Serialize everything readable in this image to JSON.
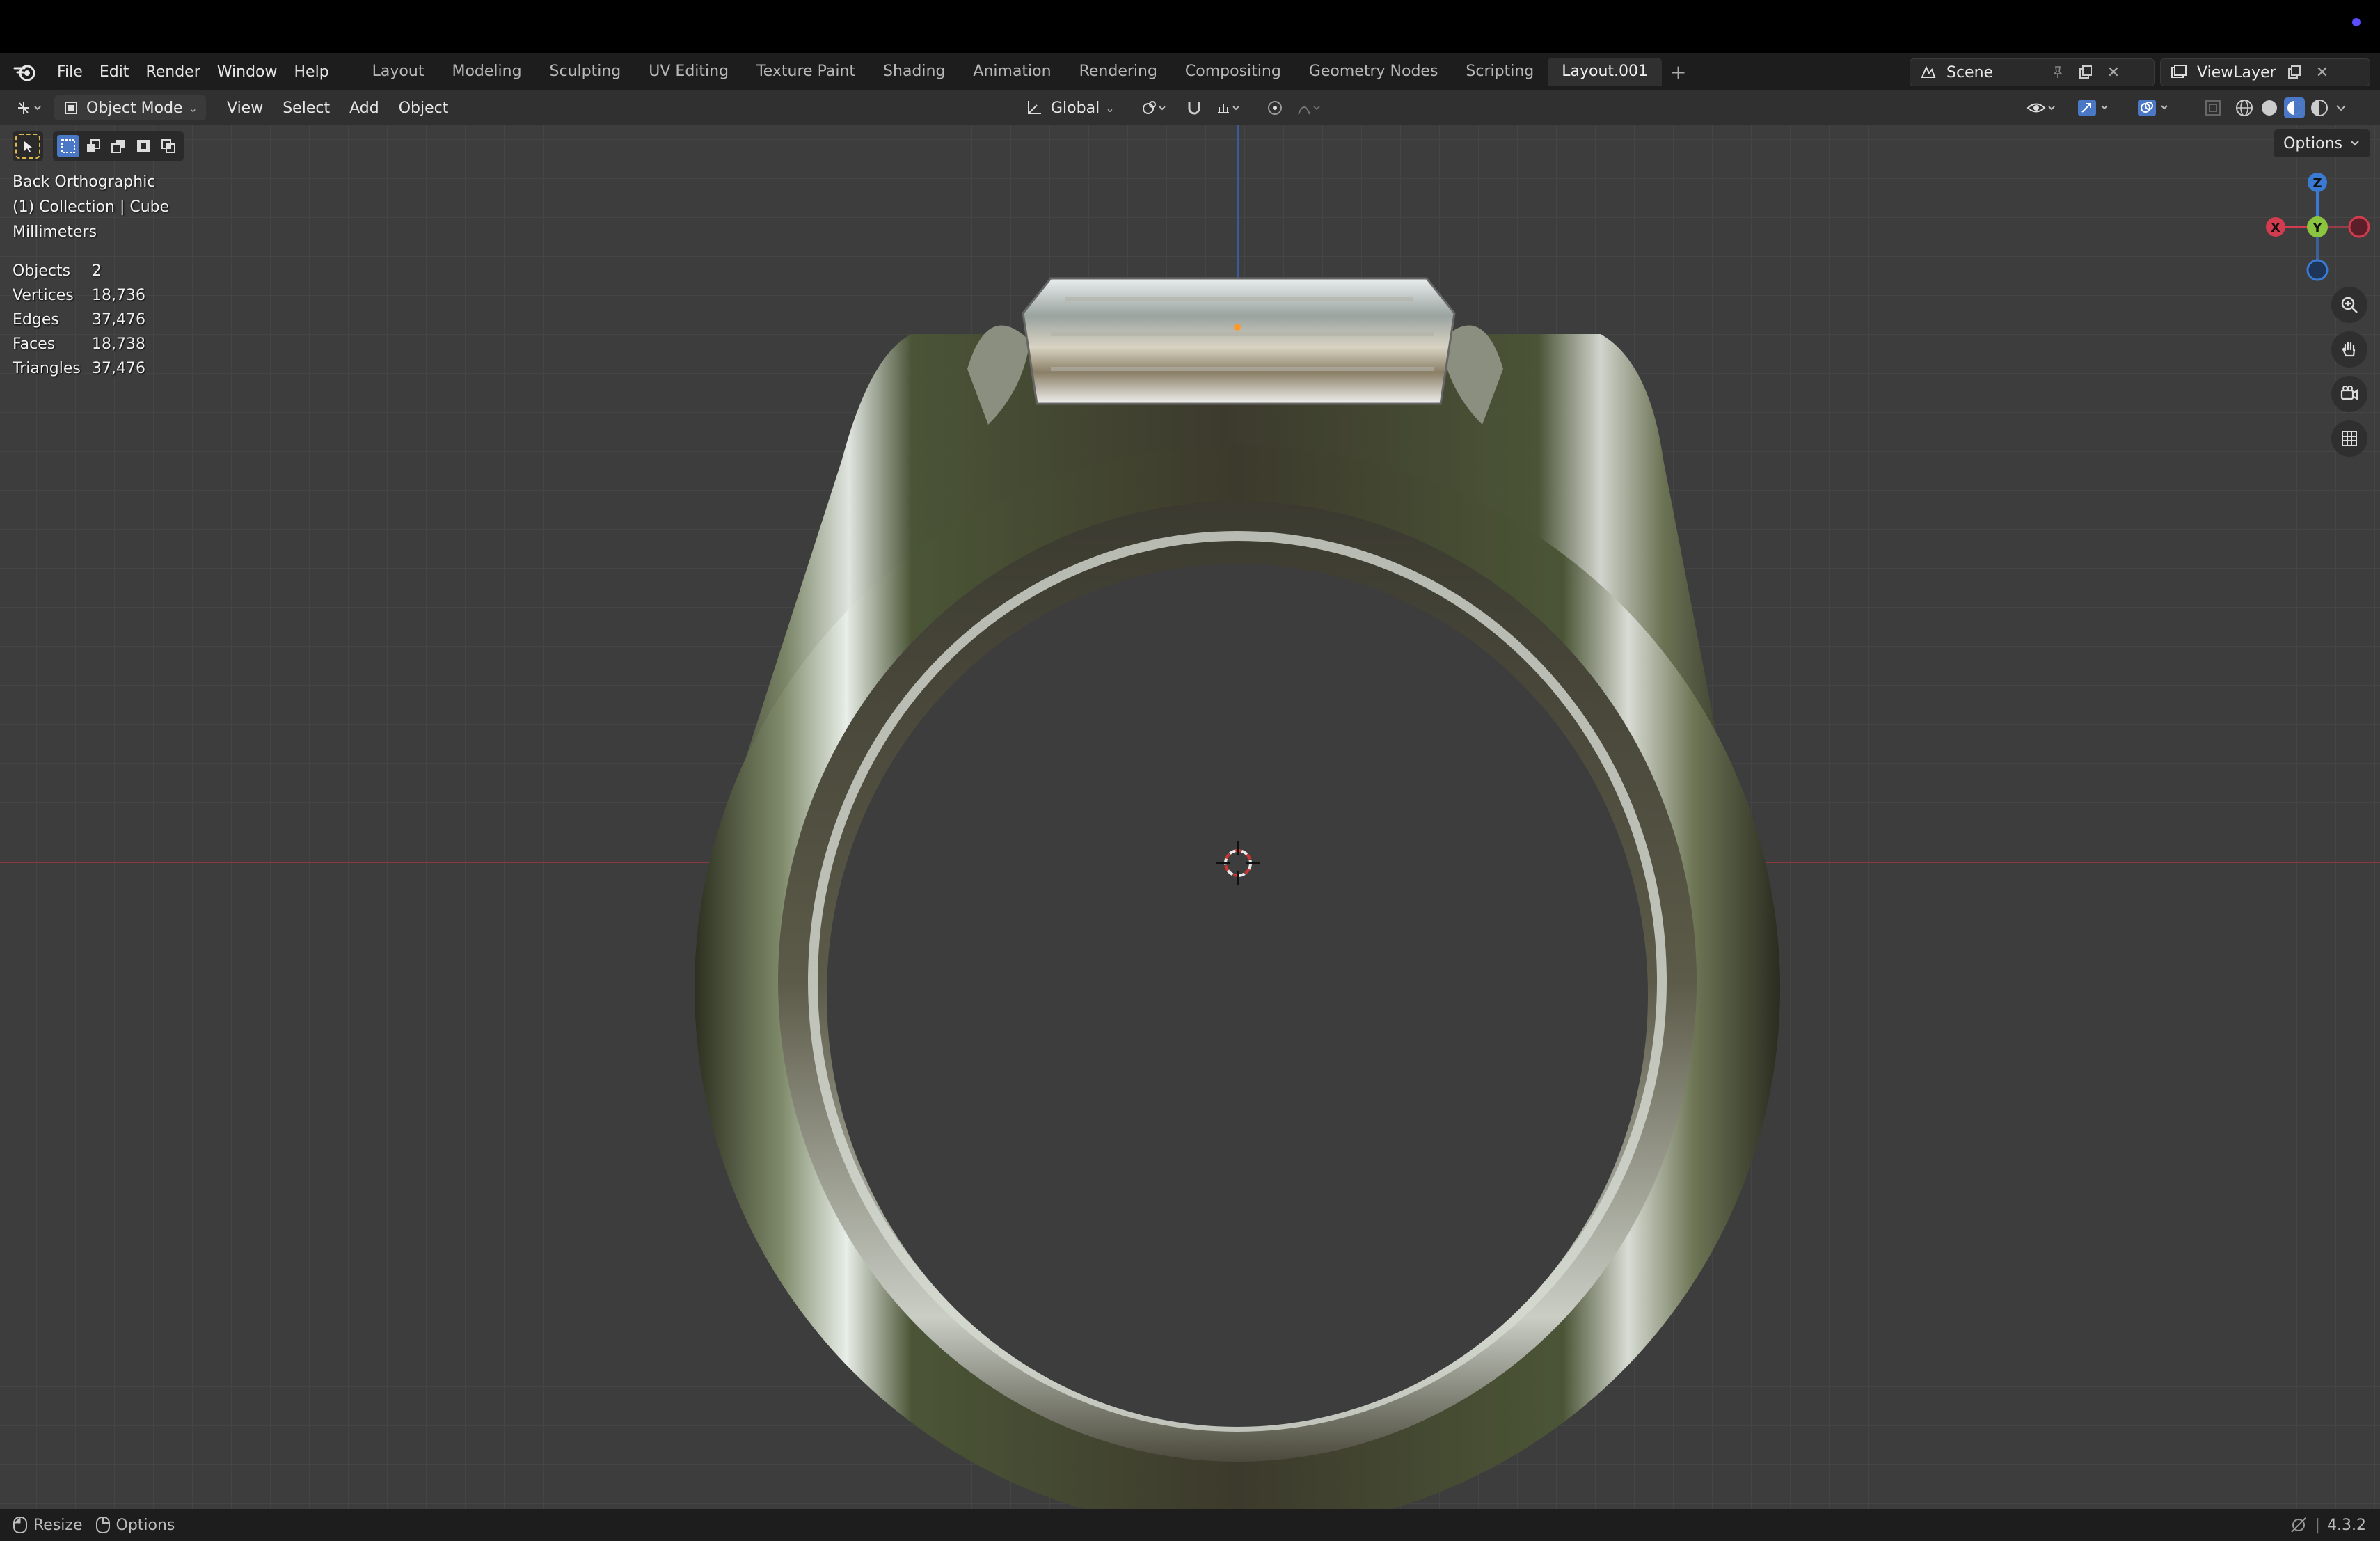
{
  "app": {
    "menus": [
      "File",
      "Edit",
      "Render",
      "Window",
      "Help"
    ],
    "workspaces": [
      "Layout",
      "Modeling",
      "Sculpting",
      "UV Editing",
      "Texture Paint",
      "Shading",
      "Animation",
      "Rendering",
      "Compositing",
      "Geometry Nodes",
      "Scripting",
      "Layout.001"
    ],
    "active_workspace": "Layout.001",
    "scene_name": "Scene",
    "view_layer_name": "ViewLayer"
  },
  "header": {
    "mode": "Object Mode",
    "menus": [
      "View",
      "Select",
      "Add",
      "Object"
    ],
    "transform_orientation": "Global"
  },
  "viewport": {
    "view_name": "Back Orthographic",
    "collection_line": "(1) Collection | Cube",
    "units": "Millimeters",
    "options_label": "Options",
    "stats": [
      {
        "label": "Objects",
        "value": "2"
      },
      {
        "label": "Vertices",
        "value": "18,736"
      },
      {
        "label": "Edges",
        "value": "37,476"
      },
      {
        "label": "Faces",
        "value": "18,738"
      },
      {
        "label": "Triangles",
        "value": "37,476"
      }
    ],
    "gizmo_axes": {
      "z": "Z",
      "x": "X",
      "y": "Y"
    }
  },
  "statusbar": {
    "left_action": "Resize",
    "right_action": "Options",
    "version": "4.3.2"
  },
  "colors": {
    "x_axis": "#d33b4f",
    "y_axis": "#8bc53f",
    "z_axis": "#3b7ad3",
    "accent": "#4a78c7"
  }
}
